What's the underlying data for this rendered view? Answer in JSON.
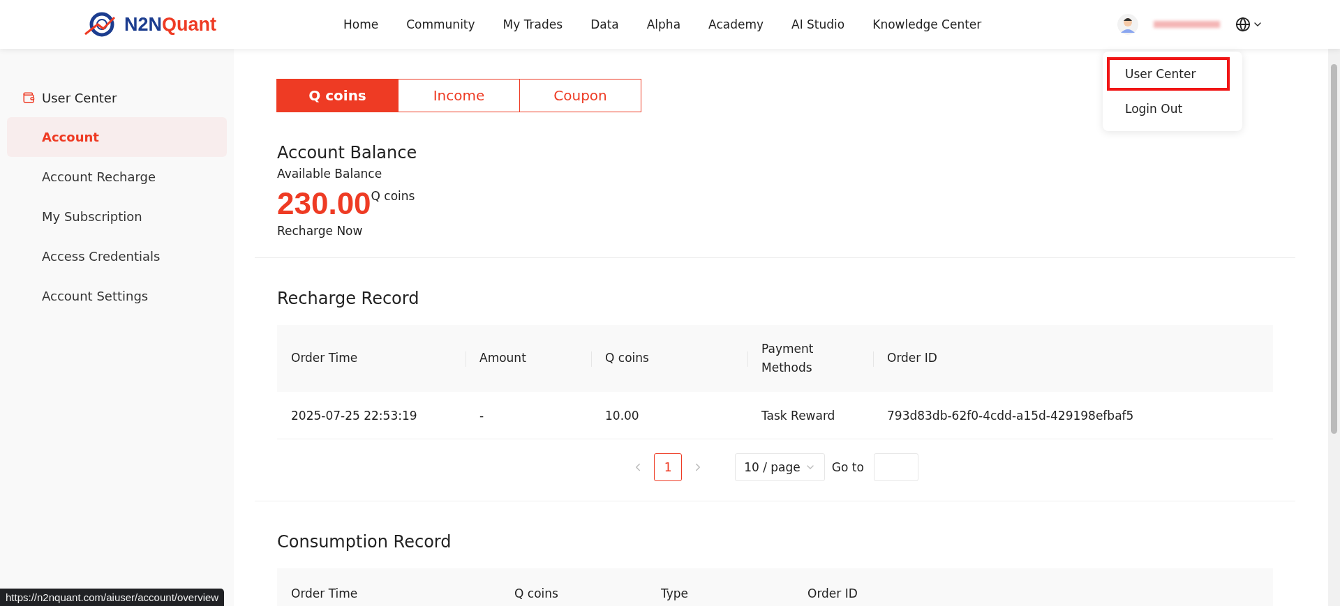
{
  "header": {
    "logo": {
      "part_1": "N2N",
      "part_2": "Quant"
    },
    "nav": [
      {
        "label": "Home"
      },
      {
        "label": "Community"
      },
      {
        "label": "My Trades"
      },
      {
        "label": "Data"
      },
      {
        "label": "Alpha"
      },
      {
        "label": "Academy"
      },
      {
        "label": "AI Studio"
      },
      {
        "label": "Knowledge Center"
      }
    ],
    "user_menu": {
      "items": [
        {
          "label": "User Center",
          "highlighted": true
        },
        {
          "label": "Login Out",
          "highlighted": false
        }
      ]
    }
  },
  "sidebar": {
    "title": "User Center",
    "items": [
      {
        "label": "Account",
        "selected": true
      },
      {
        "label": "Account Recharge",
        "selected": false
      },
      {
        "label": "My Subscription",
        "selected": false
      },
      {
        "label": "Access Credentials",
        "selected": false
      },
      {
        "label": "Account Settings",
        "selected": false
      }
    ]
  },
  "tabs": [
    {
      "label": "Q coins",
      "selected": true
    },
    {
      "label": "Income",
      "selected": false
    },
    {
      "label": "Coupon",
      "selected": false
    }
  ],
  "balance": {
    "title": "Account Balance",
    "subtitle": "Available Balance",
    "amount": "230.00",
    "unit": "Q coins",
    "link": "Recharge Now"
  },
  "recharge_record": {
    "title": "Recharge Record",
    "columns": [
      "Order Time",
      "Amount",
      "Q coins",
      "Payment Methods",
      "Order ID"
    ],
    "rows": [
      [
        "2025-07-25 22:53:19",
        "-",
        "10.00",
        "Task Reward",
        "793d83db-62f0-4cdd-a15d-429198efbaf5"
      ]
    ],
    "pagination": {
      "pages": [
        {
          "label": "1",
          "selected": true
        }
      ],
      "page_size": "10 / page",
      "goto_label": "Go to"
    }
  },
  "consumption_record": {
    "title": "Consumption Record",
    "columns": [
      "Order Time",
      "Q coins",
      "Type",
      "Order ID"
    ]
  },
  "status_url": "https://n2nquant.com/aiuser/account/overview"
}
